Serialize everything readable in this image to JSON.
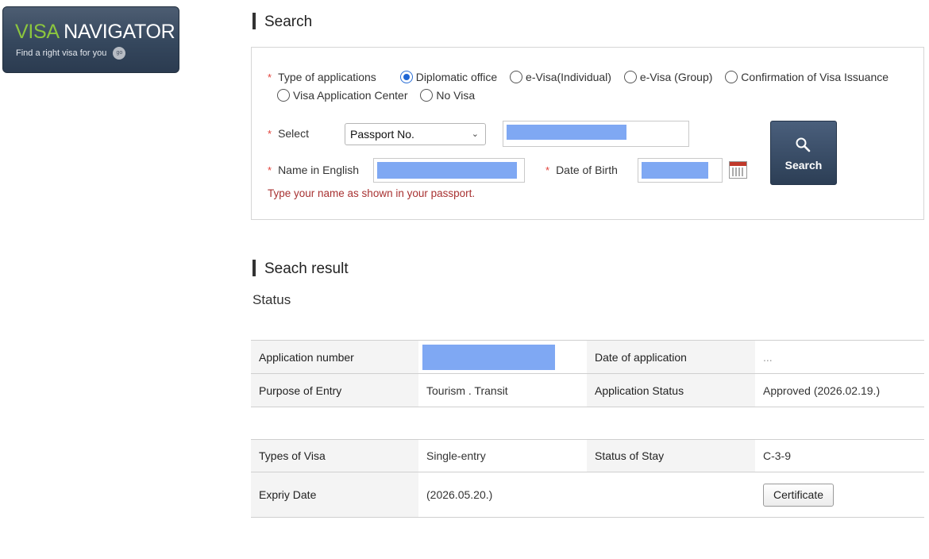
{
  "logo": {
    "word1": "VISA",
    "word2": "NAVIGATOR",
    "tagline": "Find a right visa for you",
    "go": "go"
  },
  "search": {
    "title": "Search",
    "type_label": "Type of applications",
    "types": [
      {
        "label": "Diplomatic office",
        "selected": true
      },
      {
        "label": "e-Visa(Individual)",
        "selected": false
      },
      {
        "label": "e-Visa (Group)",
        "selected": false
      },
      {
        "label": "Confirmation of Visa Issuance",
        "selected": false
      },
      {
        "label": "Visa Application Center",
        "selected": false
      },
      {
        "label": "No Visa",
        "selected": false
      }
    ],
    "select_label": "Select",
    "select_value": "Passport No.",
    "name_label": "Name in English",
    "dob_label": "Date of Birth",
    "hint": "Type your name as shown in your passport.",
    "button": "Search",
    "required_mark": "*"
  },
  "result": {
    "title": "Seach result",
    "status_title": "Status",
    "table1": {
      "application_number_label": "Application number",
      "date_of_application_label": "Date of application",
      "date_of_application_value": "...",
      "purpose_label": "Purpose of Entry",
      "purpose_value": "Tourism . Transit",
      "status_label": "Application Status",
      "status_value": "Approved (2026.02.19.)"
    },
    "table2": {
      "types_label": "Types of Visa",
      "types_value": "Single-entry",
      "stay_label": "Status of Stay",
      "stay_value": "C-3-9",
      "expiry_label": "Expriy Date",
      "expiry_value": "(2026.05.20.)",
      "certificate_button": "Certificate"
    }
  },
  "colors": {
    "redaction": "#7fa8f3",
    "logo_green": "#8cc63e",
    "required": "#e2413a",
    "hint": "#a83232"
  }
}
